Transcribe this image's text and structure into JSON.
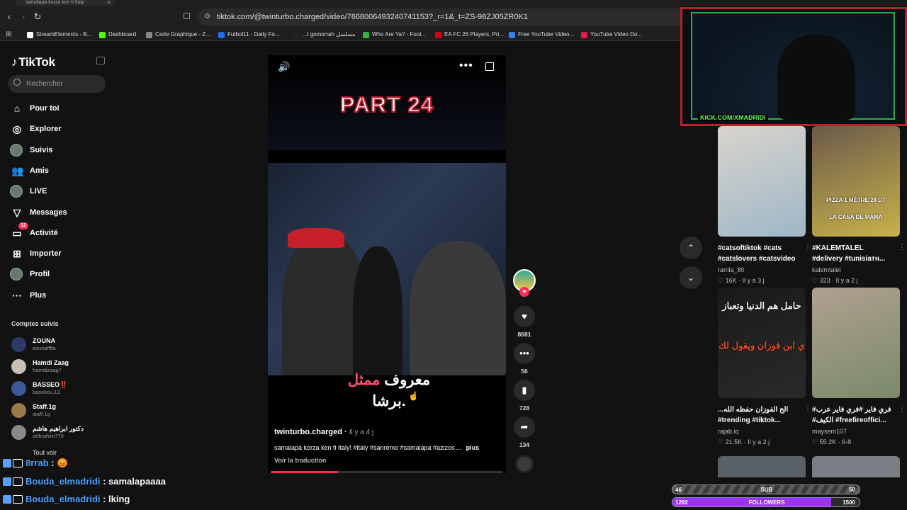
{
  "browser": {
    "tab_title": "samalapa korza ken fi Italy",
    "url": "tiktok.com/@twinturbo.charged/video/7668006493240741153?_r=1&_t=ZS-98ZJ05ZR0K1",
    "bookmarks": [
      {
        "label": "StreamElements - B...",
        "color": "#ffffff"
      },
      {
        "label": "Dashboard",
        "color": "#53fc18"
      },
      {
        "label": "Carte Graphique - Z...",
        "color": "#888888"
      },
      {
        "label": "Futbol11 - Daily Fo...",
        "color": "#1f6feb"
      },
      {
        "label": "...l gomorrah مسلسل",
        "color": "#222222"
      },
      {
        "label": "Who Are Ya? - Foot...",
        "color": "#3cb043"
      },
      {
        "label": "EA FC 26 Players, Pri...",
        "color": "#d0021b"
      },
      {
        "label": "Free YouTube Video...",
        "color": "#2f80ed"
      },
      {
        "label": "YouTube Video Do...",
        "color": "#e11d48"
      }
    ]
  },
  "sidebar": {
    "logo": "TikTok",
    "search_placeholder": "Rechercher",
    "nav": [
      {
        "label": "Pour toi",
        "icon": "home-icon"
      },
      {
        "label": "Explorer",
        "icon": "compass-icon"
      },
      {
        "label": "Suivis",
        "icon": "avatar"
      },
      {
        "label": "Amis",
        "icon": "friends-icon"
      },
      {
        "label": "LIVE",
        "icon": "avatar"
      },
      {
        "label": "Messages",
        "icon": "send-icon"
      },
      {
        "label": "Activité",
        "icon": "inbox-icon",
        "badge": "12"
      },
      {
        "label": "Importer",
        "icon": "upload-icon"
      },
      {
        "label": "Profil",
        "icon": "avatar"
      },
      {
        "label": "Plus",
        "icon": "more-icon"
      }
    ],
    "following_title": "Comptes suivis",
    "following": [
      {
        "name": "ZOUNA",
        "user": "zounaffffa",
        "color": "#2b3a66"
      },
      {
        "name": "Hamdi Zaag",
        "user": "hamdizaag7",
        "color": "#c8c0b0"
      },
      {
        "name": "BASSEO‼️",
        "user": "basekou.13",
        "color": "#3a5a9a"
      },
      {
        "name": "Staff.1g",
        "user": "staff.1g",
        "color": "#9a7a4a"
      },
      {
        "name": "دكتور ابراهيم هاشم",
        "user": "drlbrahim770",
        "color": "#8a8a8a"
      }
    ],
    "see_all": "Tout voir"
  },
  "chat": [
    {
      "user": "8rrab",
      "message": ""
    },
    {
      "user": "Bouda_elmadridi",
      "message": "samalapaaaa"
    },
    {
      "user": "Bouda_elmadridi",
      "message": "lking"
    }
  ],
  "video": {
    "overlay_title": "PART 24",
    "caption_red": "ممثل",
    "caption_white": "معروف",
    "caption_line2": "برشا.",
    "author": "twinturbo.charged",
    "date": "Il y a 4 j",
    "description": "samalapa korza ken fi Italy! #italy #sanremo #samalapa #azizos ...",
    "more": "plus",
    "translate": "Voir la traduction",
    "progress": 0.29
  },
  "actions": {
    "likes": "8681",
    "comments": "56",
    "saves": "728",
    "shares": "134"
  },
  "webcam": {
    "overlay_text": "KICK.COM/XMADRIDI"
  },
  "recommended": [
    {
      "desc1": "#catsoftiktok #cats",
      "desc2": "#catslovers #catsvideo",
      "user": "ramla_80",
      "likes": "16K",
      "date": "Il y a 3 j",
      "colors": [
        "#d8d4cc",
        "#9fb7c8"
      ]
    },
    {
      "desc1": "#KALEMTALEL",
      "desc2": "#delivery #tunisiaтн...",
      "user": "kalemtalel",
      "likes": "323",
      "date": "Il y a 2 j",
      "colors": [
        "#6a5a4a",
        "#c9b24a"
      ],
      "overlay": "PIZZA 1 MÈTRE 28 DT",
      "overlay2": "LA CASA DE MAMA"
    },
    {
      "desc1": "...الح الفوزان حفظه الله",
      "desc2": "#trending #tiktok...",
      "user": "rajab.iq",
      "likes": "21.5K",
      "date": "Il y a 2 j",
      "colors": [
        "#1a1a1a",
        "#2a2a2a"
      ],
      "overlay": "حامل هم الدنيا وتعباز",
      "overlay2": "ي ابن فوزان ويقول لك"
    },
    {
      "desc1": "#فري فاير #فري فاير عرب",
      "desc2": "#الكيف #freefireoffici...",
      "user": "maysem107",
      "likes": "55.2K",
      "date": "6-8",
      "colors": [
        "#b0a090",
        "#7a8a6a"
      ]
    }
  ],
  "stream_goals": {
    "sub": {
      "label": "SUB",
      "current": "46",
      "target": "50",
      "progress": 0.92
    },
    "followers": {
      "label": "FOLLOWERS",
      "current": "1282",
      "target": "1500",
      "progress": 0.85
    }
  }
}
